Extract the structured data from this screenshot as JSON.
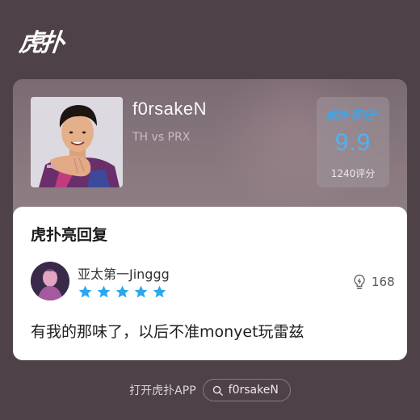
{
  "app": {
    "logo_text": "虎扑"
  },
  "player": {
    "name": "f0rsakeN",
    "match": "TH vs PRX"
  },
  "score": {
    "brand": "虎扑评分",
    "value": "9.9",
    "count_label": "1240评分"
  },
  "reply": {
    "section_title": "虎扑亮回复",
    "user_name": "亚太第一Jinggg",
    "stars": 5,
    "likes": "168",
    "comment": "有我的那味了，以后不准monyet玩雷兹"
  },
  "footer": {
    "open_app": "打开虎扑APP",
    "search_text": "f0rsakeN"
  },
  "colors": {
    "background": "#4e4248",
    "accent_blue": "#4fb2f2",
    "star_blue": "#2aa7ee"
  }
}
